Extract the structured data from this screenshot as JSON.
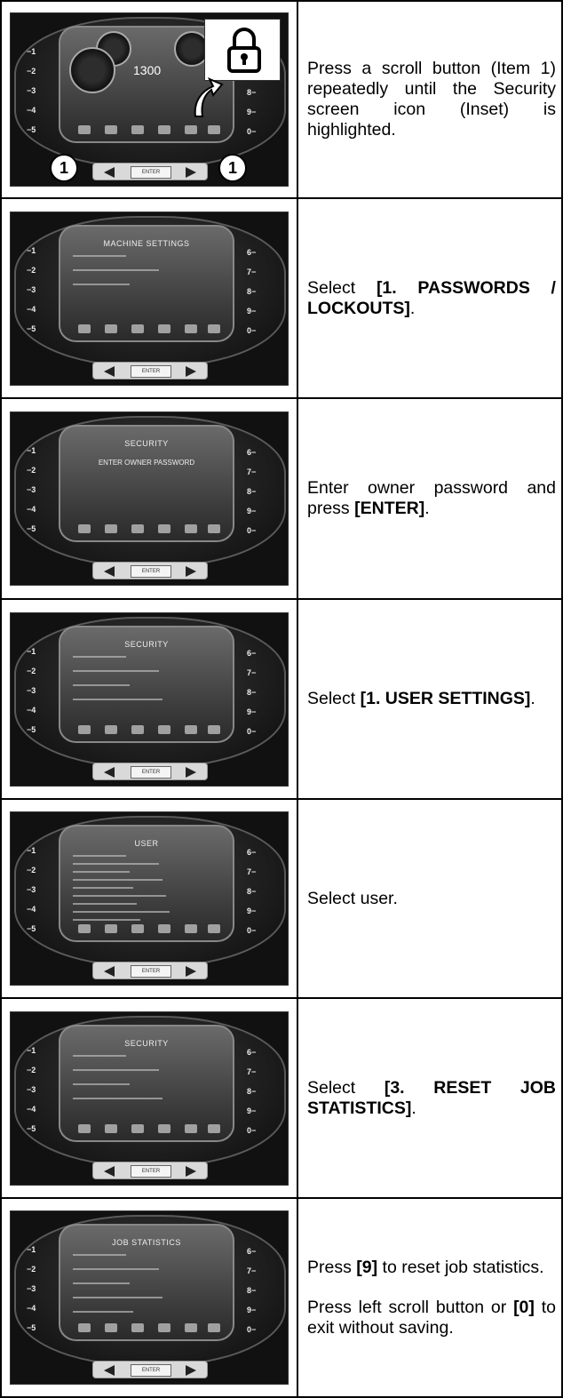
{
  "steps": [
    {
      "image": {
        "keys_left": [
          "1",
          "2",
          "3",
          "4",
          "5"
        ],
        "keys_right": [
          "6",
          "7",
          "8",
          "9",
          "0"
        ],
        "enter_label": "ENTER",
        "rpm": "1300",
        "callout_left": "1",
        "callout_right": "1",
        "inset_icon": "padlock-icon"
      },
      "text": [
        {
          "parts": [
            {
              "t": "Press a scroll button (Item 1) repeatedly until the Security screen icon (Inset) is highlighted."
            }
          ]
        }
      ]
    },
    {
      "image": {
        "screen_title": "MACHINE SETTINGS",
        "lines": 3,
        "enter_label": "ENTER"
      },
      "text": [
        {
          "parts": [
            {
              "t": "Select "
            },
            {
              "t": "[1. PASSWORDS / LOCKOUTS]",
              "b": true
            },
            {
              "t": "."
            }
          ]
        }
      ]
    },
    {
      "image": {
        "screen_title": "SECURITY",
        "prompt": "ENTER OWNER PASSWORD",
        "enter_label": "ENTER"
      },
      "text": [
        {
          "parts": [
            {
              "t": "Enter owner password and press "
            },
            {
              "t": "[ENTER]",
              "b": true
            },
            {
              "t": "."
            }
          ]
        }
      ]
    },
    {
      "image": {
        "screen_title": "SECURITY",
        "lines": 4,
        "enter_label": "ENTER"
      },
      "text": [
        {
          "parts": [
            {
              "t": "Select "
            },
            {
              "t": "[1. USER SETTINGS]",
              "b": true
            },
            {
              "t": "."
            }
          ]
        }
      ]
    },
    {
      "image": {
        "screen_title": "USER",
        "lines": 9,
        "enter_label": "ENTER"
      },
      "text": [
        {
          "parts": [
            {
              "t": "Select user."
            }
          ]
        }
      ]
    },
    {
      "image": {
        "screen_title": "SECURITY",
        "lines": 4,
        "enter_label": "ENTER"
      },
      "text": [
        {
          "parts": [
            {
              "t": "Select "
            },
            {
              "t": "[3. RESET JOB STATISTICS]",
              "b": true
            },
            {
              "t": "."
            }
          ]
        }
      ]
    },
    {
      "image": {
        "screen_title": "JOB STATISTICS",
        "lines": 5,
        "enter_label": "ENTER"
      },
      "text": [
        {
          "parts": [
            {
              "t": "Press "
            },
            {
              "t": "[9]",
              "b": true
            },
            {
              "t": " to reset job statistics."
            }
          ]
        },
        {
          "parts": [
            {
              "t": "Press left scroll button or "
            },
            {
              "t": "[0]",
              "b": true
            },
            {
              "t": " to exit without saving."
            }
          ]
        }
      ]
    }
  ]
}
